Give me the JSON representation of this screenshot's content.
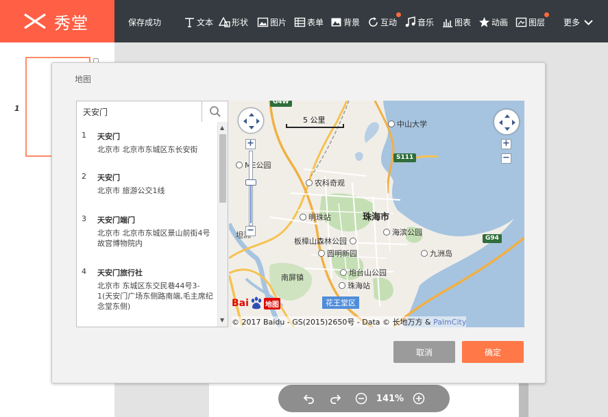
{
  "app": {
    "logo_text": "秀堂",
    "save_status": "保存成功",
    "brand_color": "#ff5f45",
    "toolbar_bg": "#353b40"
  },
  "toolbar": {
    "items": [
      {
        "label": "文本",
        "icon": "text-icon"
      },
      {
        "label": "形状",
        "icon": "shape-icon"
      },
      {
        "label": "图片",
        "icon": "image-icon"
      },
      {
        "label": "表单",
        "icon": "form-icon"
      },
      {
        "label": "背景",
        "icon": "background-icon"
      },
      {
        "label": "互动",
        "icon": "refresh-icon",
        "badge": true
      },
      {
        "label": "音乐",
        "icon": "music-icon"
      },
      {
        "label": "图表",
        "icon": "chart-icon"
      },
      {
        "label": "动画",
        "icon": "star-icon"
      },
      {
        "label": "图层",
        "icon": "layer-icon",
        "badge": true
      },
      {
        "label": "更多",
        "icon": "chevron-down-icon"
      }
    ]
  },
  "pages": {
    "current_page_number": "1"
  },
  "dialog": {
    "title": "地图",
    "search": {
      "value": "天安门",
      "placeholder": ""
    },
    "results": [
      {
        "num": "1",
        "name": "天安门",
        "address": "北京市 北京市东城区东长安街"
      },
      {
        "num": "2",
        "name": "天安门",
        "address": "北京市 旅游公交1线"
      },
      {
        "num": "3",
        "name": "天安门端门",
        "address": "北京市 北京市东城区景山前街4号故宫博物院内"
      },
      {
        "num": "4",
        "name": "天安门旅行社",
        "address": "北京市 东城区东交民巷44号3-1(天安门广场东侧路南端,毛主席纪念堂东侧)"
      }
    ],
    "map": {
      "scale": "5 公里",
      "city": "珠海市",
      "labels": {
        "zhongshan_univ": "中山大学",
        "me_park": "ME公园",
        "nongke": "农科奇观",
        "mingzhu": "明珠站",
        "banzhangshan": "板樟山森林公园",
        "haibin": "海滨公园",
        "jiuzhou": "九洲岛",
        "yuanming": "圆明新园",
        "paotai": "炮台山公园",
        "nanping": "南屏镇",
        "zhuhai_station": "珠海站",
        "tan": "坦洲",
        "district": "花王堂区"
      },
      "roads": [
        "G4W",
        "S111",
        "G94"
      ],
      "logo": {
        "text": "Bai",
        "map": "地图"
      },
      "copyright": "© 2017 Baidu - GS(2015)2650号 - Data © 长地万方 &",
      "copyright_link": "PalmCity"
    },
    "buttons": {
      "cancel": "取消",
      "ok": "确定"
    }
  },
  "zoom": {
    "value": "141%"
  }
}
